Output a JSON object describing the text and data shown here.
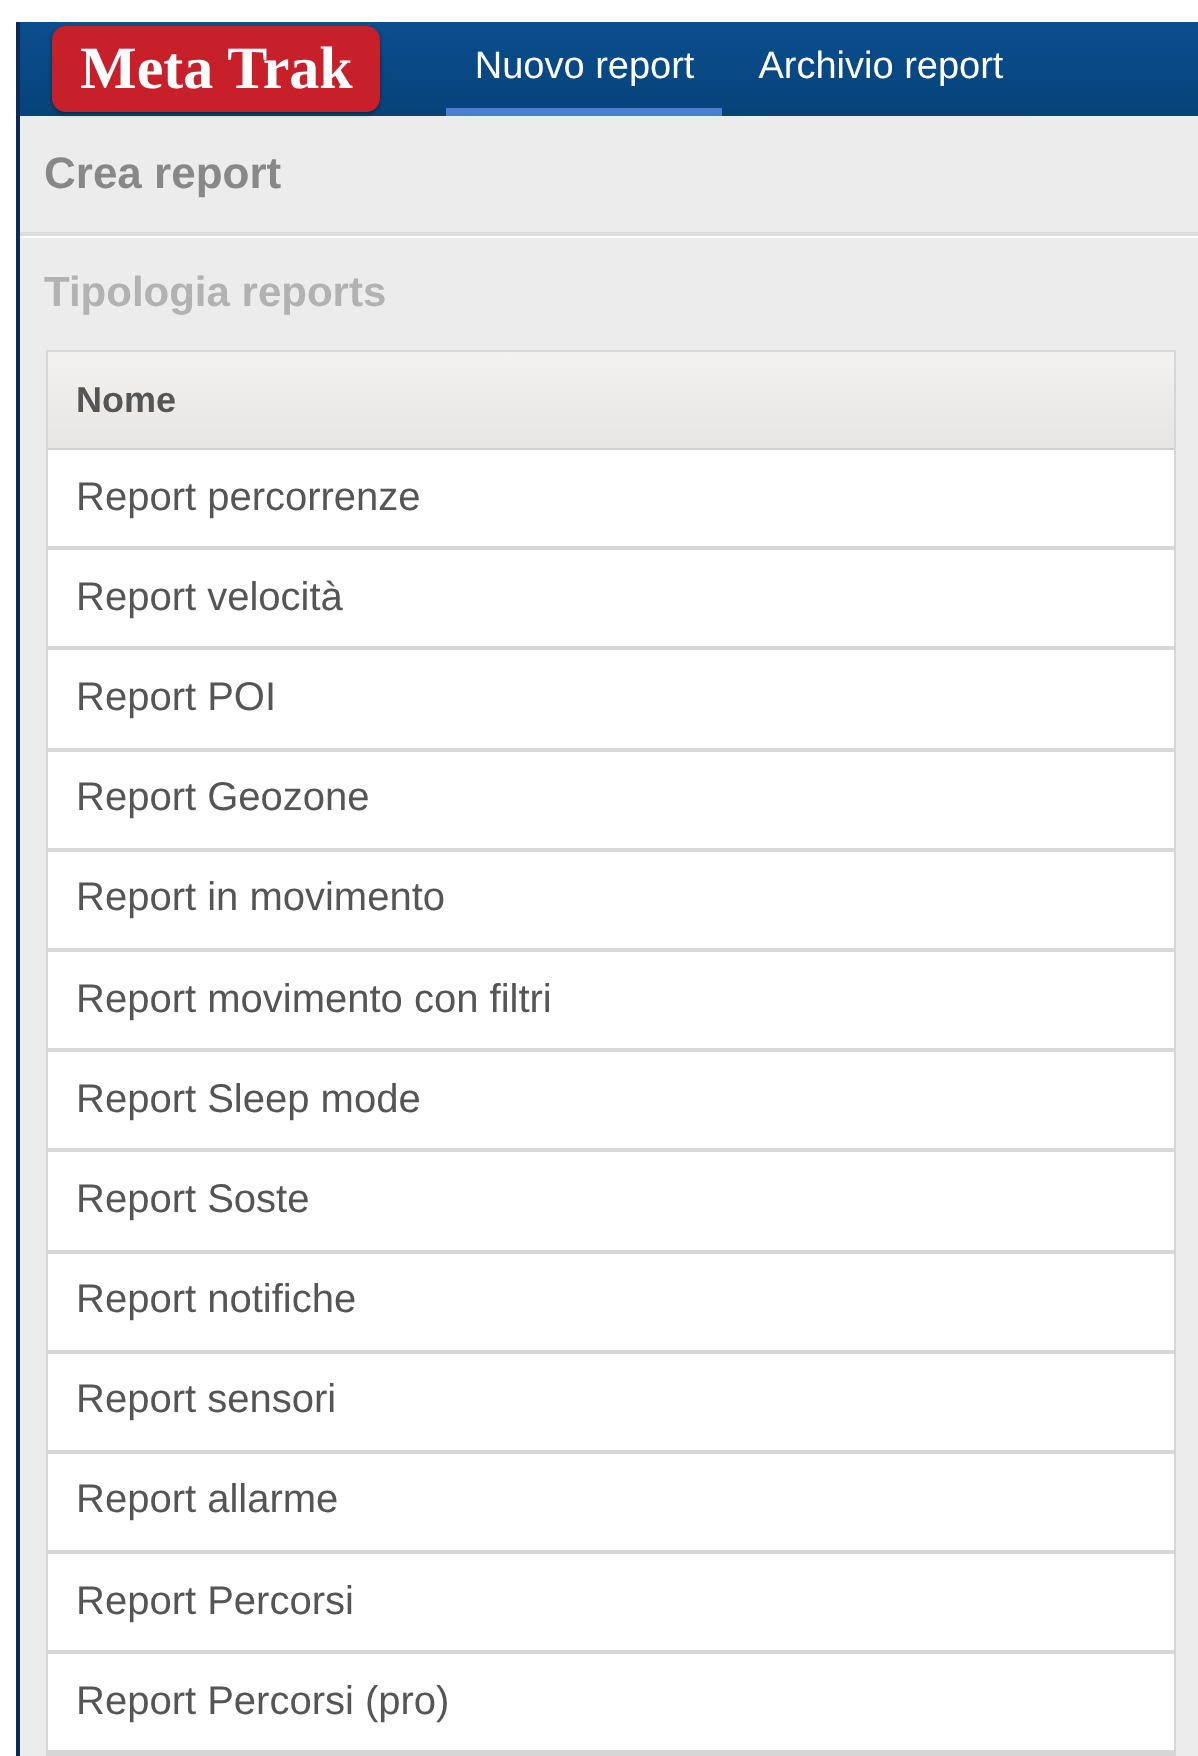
{
  "header": {
    "logo": "Meta Trak",
    "tabs": [
      {
        "label": "Nuovo report",
        "selected": true
      },
      {
        "label": "Archivio report",
        "selected": false
      }
    ]
  },
  "panel_title": "Crea report",
  "section_title": "Tipologia reports",
  "table": {
    "columns": [
      "Nome"
    ],
    "rows": [
      "Report percorrenze",
      "Report velocità",
      "Report POI",
      "Report Geozone",
      "Report in movimento",
      "Report movimento con filtri",
      "Report Sleep mode",
      "Report Soste",
      "Report notifiche",
      "Report sensori",
      "Report allarme",
      "Report Percorsi",
      "Report Percorsi (pro)"
    ]
  }
}
